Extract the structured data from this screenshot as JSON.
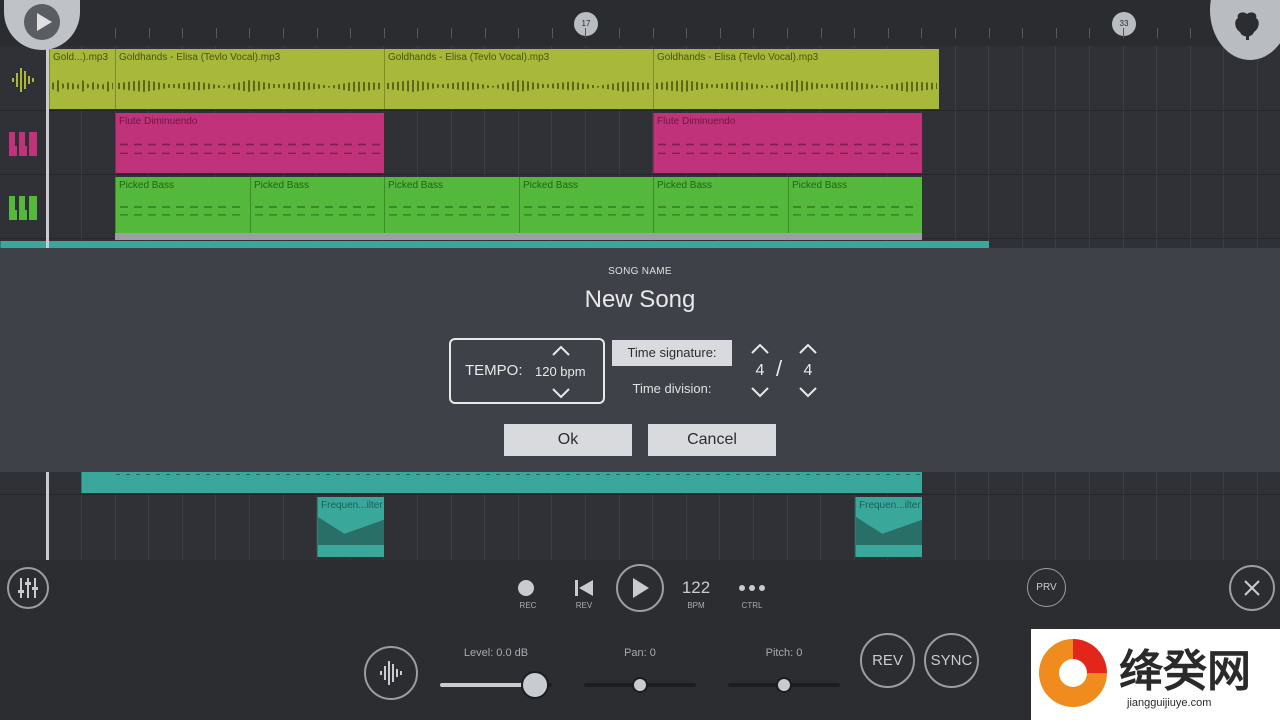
{
  "ruler": {
    "markers": [
      "17",
      "33"
    ]
  },
  "tracks": {
    "audio_clips": [
      "Gold...).mp3",
      "Goldhands - Elisa (Tevlo Vocal).mp3",
      "Goldhands - Elisa (Tevlo Vocal).mp3",
      "Goldhands - Elisa (Tevlo Vocal).mp3"
    ],
    "flute_clips": [
      "Flute Diminuendo",
      "Flute Diminuendo"
    ],
    "bass_clips": [
      "Picked Bass",
      "Picked Bass",
      "Picked Bass",
      "Picked Bass",
      "Picked Bass",
      "Picked Bass"
    ],
    "filter_clips": [
      "Frequen...ilter",
      "Frequen...ilter"
    ],
    "colors": {
      "audio": "#a8b83a",
      "flute": "#c0337a",
      "bass": "#54b83c",
      "teal": "#3aa79b"
    }
  },
  "dialog": {
    "song_name_label": "SONG NAME",
    "song_name": "New Song",
    "tempo_label": "TEMPO:",
    "tempo_value": "120 bpm",
    "time_signature_label": "Time signature:",
    "time_division_label": "Time division:",
    "ts_numerator": "4",
    "ts_denominator": "4",
    "ts_separator": "/",
    "ok_label": "Ok",
    "cancel_label": "Cancel"
  },
  "transport": {
    "rec_label": "REC",
    "rev_label": "REV",
    "bpm_value": "122",
    "bpm_label": "BPM",
    "ctrl_label": "CTRL",
    "prv_label": "PRV"
  },
  "mixer": {
    "level_label": "Level: 0.0 dB",
    "pan_label": "Pan: 0",
    "pitch_label": "Pitch: 0",
    "rev_button": "REV",
    "sync_button": "SYNC",
    "level_value": 0.85,
    "pan_value": 0.5,
    "pitch_value": 0.5
  },
  "watermark": {
    "text": "绛癸网",
    "url": "jiangguijiuye.com"
  }
}
